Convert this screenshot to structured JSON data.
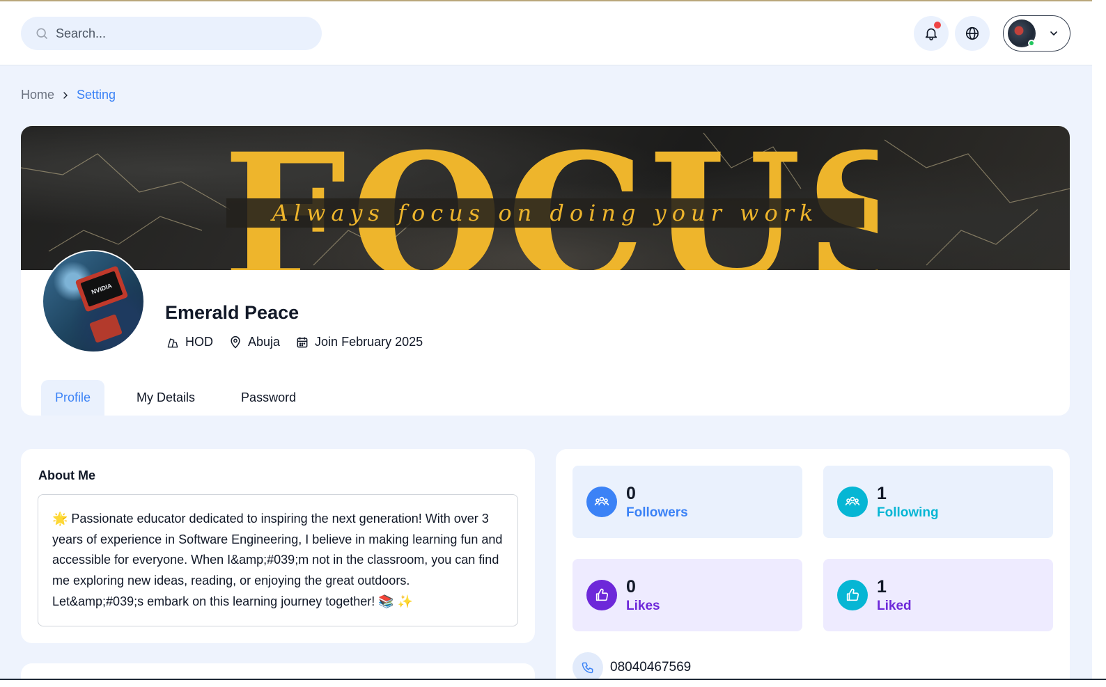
{
  "header": {
    "search_placeholder": "Search...",
    "notification_icon": "bell-icon",
    "language_icon": "globe-icon",
    "notification_dot_color": "#ef4444",
    "online_status_color": "#22c55e"
  },
  "breadcrumb": {
    "home": "Home",
    "current": "Setting"
  },
  "cover": {
    "word": "FOCUS",
    "tagline": "Always focus on doing your work",
    "accent_color": "#eeb52c"
  },
  "profile": {
    "name": "Emerald Peace",
    "role": "HOD",
    "location": "Abuja",
    "joined": "Join February 2025",
    "avatar_chip_text": "NVIDIA"
  },
  "tabs": [
    {
      "label": "Profile",
      "active": true
    },
    {
      "label": "My Details",
      "active": false
    },
    {
      "label": "Password",
      "active": false
    }
  ],
  "about": {
    "title": "About Me",
    "text": "🌟 Passionate educator dedicated to inspiring the next generation! With over 3 years of experience in Software Engineering, I believe in making learning fun and accessible for everyone. When I&amp;#039;m not in the classroom, you can find me exploring new ideas, reading, or enjoying the great outdoors. Let&amp;#039;s embark on this learning journey together! 📚 ✨"
  },
  "stats": [
    {
      "value": "0",
      "label": "Followers",
      "icon": "users-icon",
      "color": "#3b82f6"
    },
    {
      "value": "1",
      "label": "Following",
      "icon": "users-icon",
      "color": "#06b6d4"
    },
    {
      "value": "0",
      "label": "Likes",
      "icon": "thumbs-up-icon",
      "color": "#6d28d9"
    },
    {
      "value": "1",
      "label": "Liked",
      "icon": "thumbs-up-icon",
      "color": "#06b6d4"
    }
  ],
  "contact": {
    "phone": "08040467569",
    "phone_icon": "phone-icon"
  }
}
